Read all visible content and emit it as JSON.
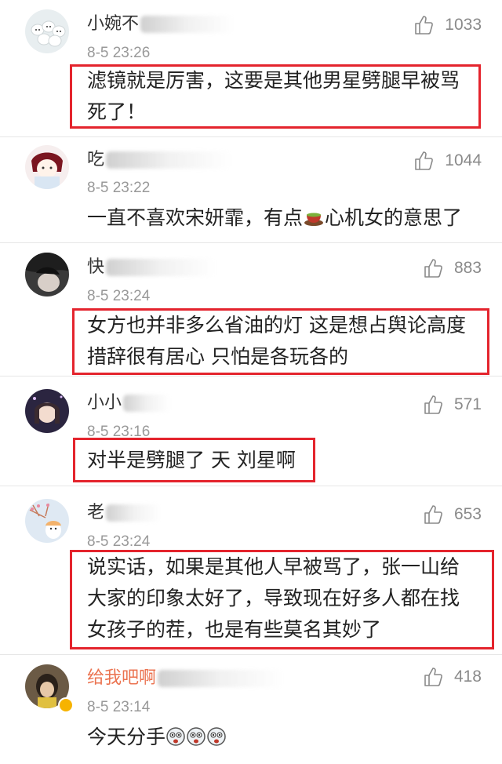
{
  "colors": {
    "highlight_border": "#e4242d",
    "vip_name": "#eb7350",
    "timestamp": "#999999",
    "like_count": "#8a8a8a"
  },
  "comments": [
    {
      "username": "小婉不",
      "time": "8-5 23:26",
      "likes": "1033",
      "text": [
        "滤镜就是厉害，这要是其他男星劈腿早被骂",
        "死了！"
      ],
      "highlighted": true
    },
    {
      "username": "吃",
      "time": "8-5 23:22",
      "likes": "1044",
      "text_before_emoji": "一直不喜欢宋妍霏，有点",
      "emoji": "tea-cup-emoji",
      "text_after_emoji": "心机女的意思了",
      "highlighted": false
    },
    {
      "username": "快",
      "time": "8-5 23:24",
      "likes": "883",
      "text": [
        "女方也并非多么省油的灯 这是想占舆论高度",
        "措辞很有居心 只怕是各玩各的"
      ],
      "highlighted": true
    },
    {
      "username": "小小",
      "time": "8-5 23:16",
      "likes": "571",
      "text": [
        "对半是劈腿了 天 刘星啊"
      ],
      "highlighted": true
    },
    {
      "username": "老",
      "time": "8-5 23:24",
      "likes": "653",
      "text": [
        "说实话，如果是其他人早被骂了，张一山给",
        "大家的印象太好了，导致现在好多人都在找",
        "女孩子的茬，也是有些莫名其妙了"
      ],
      "highlighted": true
    },
    {
      "username": "给我吧啊",
      "time": "8-5 23:14",
      "likes": "418",
      "text_before_emoji": "今天分手",
      "emoji": "shocked-face-emoji",
      "highlighted": false,
      "vip": true
    }
  ]
}
